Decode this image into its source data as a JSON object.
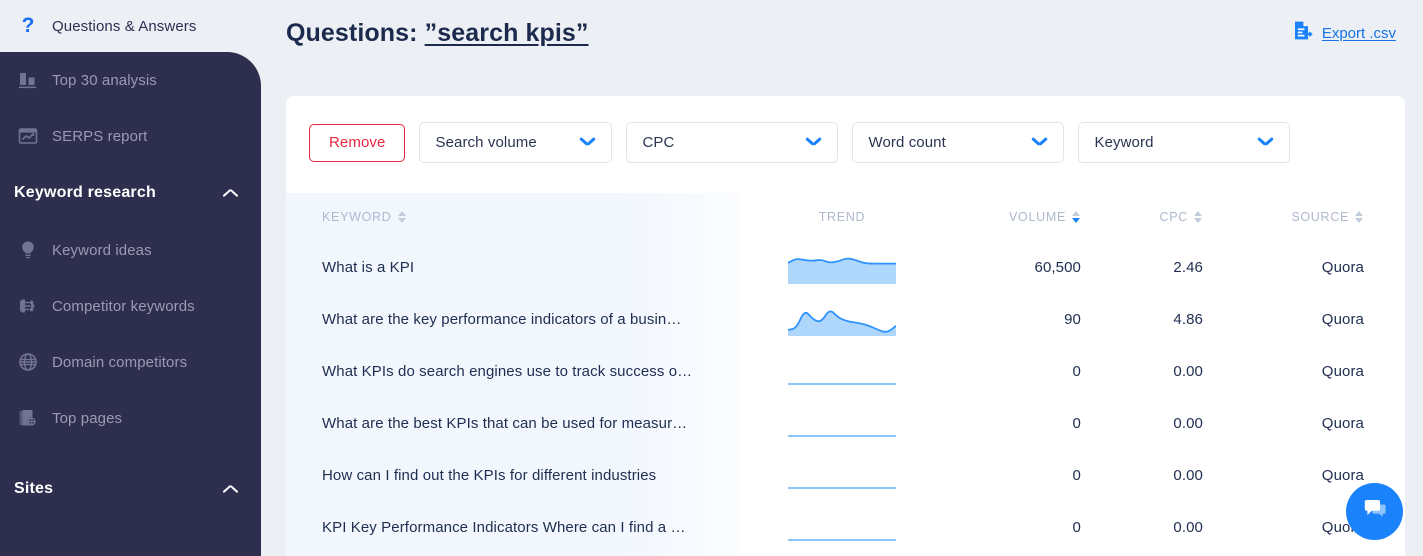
{
  "sidebar": {
    "top_item": {
      "label": "Questions & Answers",
      "icon": "question-mark-icon"
    },
    "items": [
      {
        "label": "Top 30 analysis",
        "icon": "bar-chart-icon"
      },
      {
        "label": "SERPS report",
        "icon": "serps-window-icon"
      }
    ],
    "sections": [
      {
        "label": "Keyword research",
        "expanded": true,
        "items": [
          {
            "label": "Keyword ideas",
            "icon": "lightbulb-icon"
          },
          {
            "label": "Competitor keywords",
            "icon": "network-nodes-icon"
          },
          {
            "label": "Domain competitors",
            "icon": "globe-icon"
          },
          {
            "label": "Top pages",
            "icon": "pages-globe-icon"
          }
        ]
      },
      {
        "label": "Sites",
        "expanded": true,
        "items": []
      }
    ]
  },
  "header": {
    "title_prefix": "Questions: ",
    "title_term": "”search kpis”",
    "export_label": "Export .csv",
    "export_icon": "file-export-icon"
  },
  "filters": {
    "remove_label": "Remove",
    "dropdowns": [
      {
        "label": "Search volume"
      },
      {
        "label": "CPC"
      },
      {
        "label": "Word count"
      },
      {
        "label": "Keyword"
      }
    ]
  },
  "table": {
    "columns": [
      {
        "key": "keyword",
        "label": "KEYWORD",
        "sortable": true,
        "sort": "none"
      },
      {
        "key": "trend",
        "label": "TREND",
        "sortable": false,
        "sort": "none"
      },
      {
        "key": "volume",
        "label": "VOLUME",
        "sortable": true,
        "sort": "desc"
      },
      {
        "key": "cpc",
        "label": "CPC",
        "sortable": true,
        "sort": "none"
      },
      {
        "key": "source",
        "label": "SOURCE",
        "sortable": true,
        "sort": "none"
      }
    ],
    "rows": [
      {
        "keyword": "What is a KPI",
        "volume": "60,500",
        "cpc": "2.46",
        "source": "Quora",
        "trend_type": "area",
        "trend_points": [
          0.62,
          0.75,
          0.7,
          0.68,
          0.72,
          0.62,
          0.66,
          0.76,
          0.72,
          0.62,
          0.6,
          0.6,
          0.6,
          0.6
        ]
      },
      {
        "keyword": "What are the key performance indicators of a busin…",
        "volume": "90",
        "cpc": "4.86",
        "source": "Quora",
        "trend_type": "area",
        "trend_points": [
          0.18,
          0.22,
          0.78,
          0.48,
          0.4,
          0.8,
          0.55,
          0.44,
          0.4,
          0.36,
          0.28,
          0.16,
          0.1,
          0.3
        ]
      },
      {
        "keyword": "What KPIs do search engines use to track success o…",
        "volume": "0",
        "cpc": "0.00",
        "source": "Quora",
        "trend_type": "flat",
        "trend_points": [
          0,
          0,
          0,
          0,
          0,
          0,
          0,
          0,
          0,
          0,
          0,
          0,
          0,
          0
        ]
      },
      {
        "keyword": "What are the best KPIs that can be used for measur…",
        "volume": "0",
        "cpc": "0.00",
        "source": "Quora",
        "trend_type": "flat",
        "trend_points": [
          0,
          0,
          0,
          0,
          0,
          0,
          0,
          0,
          0,
          0,
          0,
          0,
          0,
          0
        ]
      },
      {
        "keyword": "How can I find out the KPIs for different industries",
        "volume": "0",
        "cpc": "0.00",
        "source": "Quora",
        "trend_type": "flat",
        "trend_points": [
          0,
          0,
          0,
          0,
          0,
          0,
          0,
          0,
          0,
          0,
          0,
          0,
          0,
          0
        ]
      },
      {
        "keyword": "KPI Key Performance Indicators Where can I find a …",
        "volume": "0",
        "cpc": "0.00",
        "source": "Quora",
        "trend_type": "flat",
        "trend_points": [
          0,
          0,
          0,
          0,
          0,
          0,
          0,
          0,
          0,
          0,
          0,
          0,
          0,
          0
        ]
      }
    ]
  },
  "chat": {
    "icon": "chat-bubble-icon"
  },
  "colors": {
    "sidebar_dark": "#2e2e4f",
    "page_bg": "#eceff3",
    "accent_blue": "#1a82fb",
    "link_blue": "#1473e6",
    "danger_red": "#e8283f",
    "title_navy": "#1c2a4e",
    "spark_fill": "#aed7fb",
    "spark_stroke": "#2f93fc",
    "keyword_col_bg": "#f2f7fe"
  }
}
